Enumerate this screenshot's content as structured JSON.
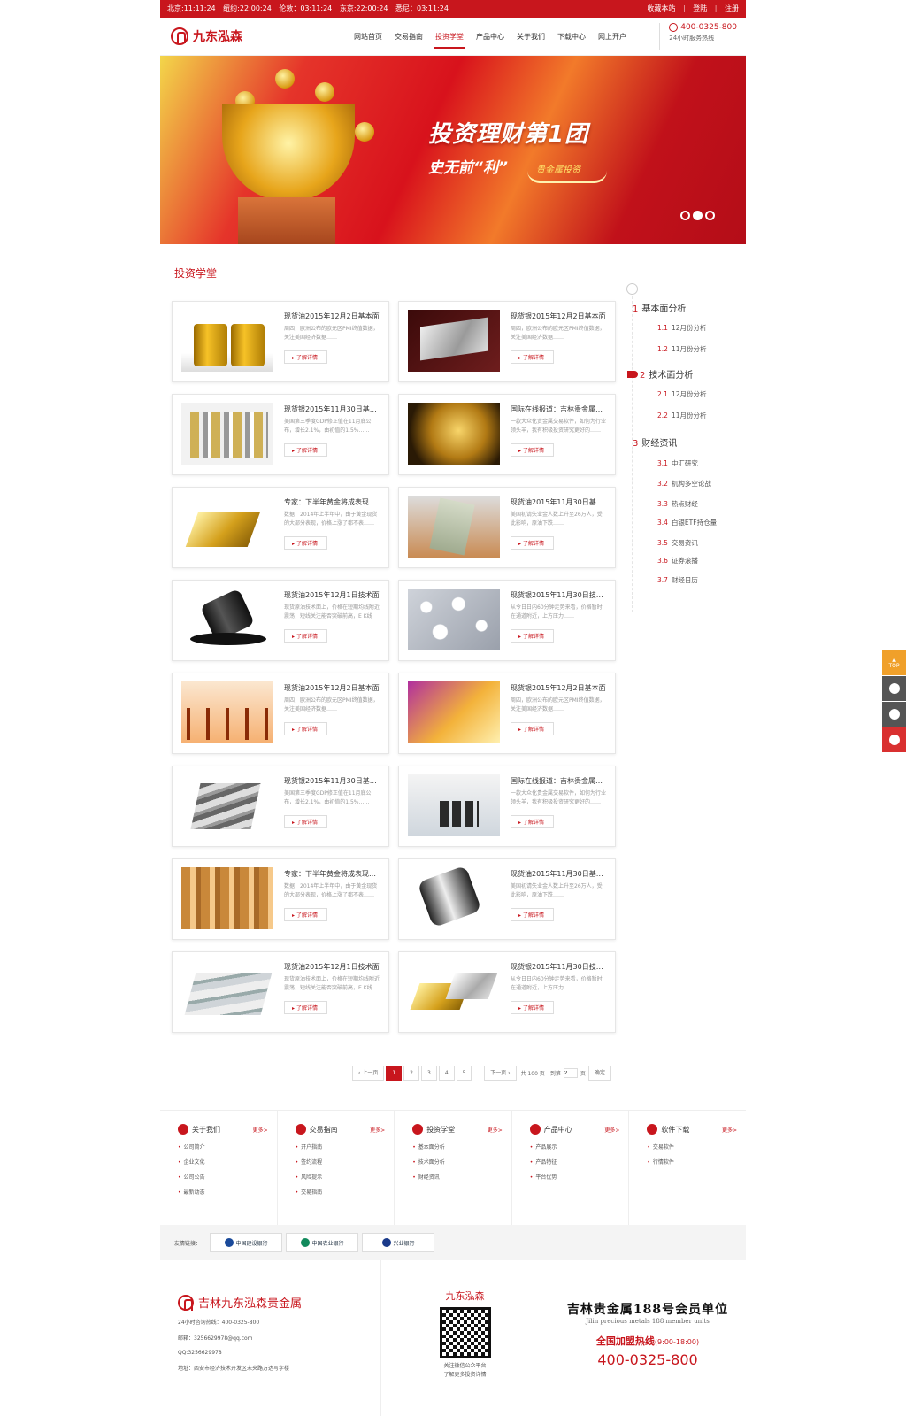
{
  "topbar": {
    "clocks": [
      "北京:11:11:24",
      "纽约:22:00:24",
      "伦敦：03:11:24",
      "东京:22:00:24",
      "悉尼：03:11:24"
    ],
    "links": [
      "收藏本站",
      "登陆",
      "注册"
    ]
  },
  "header": {
    "logo_text": "九东泓森",
    "nav": [
      "网站首页",
      "交易指南",
      "投资学堂",
      "产品中心",
      "关于我们",
      "下载中心",
      "网上开户"
    ],
    "active_nav": "投资学堂",
    "hotline": "400-0325-800",
    "hotline_sub": "24小时服务热线"
  },
  "banner": {
    "title": "投资理财第1团",
    "subtitle": "史无前“利”",
    "tag": "贵金属投资"
  },
  "section_title": "投资学堂",
  "more_label": "了解详情",
  "articles": [
    {
      "title": "现货油2015年12月2日基本面",
      "desc": "周四，欧洲公布的欧元区PMI终值数据，关注美国经济数据……",
      "thumb": "oil-barrels"
    },
    {
      "title": "现货银2015年12月2日基本面",
      "desc": "周四，欧洲公布的欧元区PMI终值数据，关注美国经济数据……",
      "thumb": "silver-bar"
    },
    {
      "title": "现货银2015年11月30日基本面",
      "desc": "美国第三季度GDP修正值在11月底公布，增长2.1%，由初值的1.5%……",
      "thumb": "gold-silver-stacks"
    },
    {
      "title": "国际在线报道：吉林贵金属……",
      "desc": "一款大众化贵金属交易软件，如何为行业领头羊，我有积极投资研究更好的……",
      "thumb": "gold-nugget"
    },
    {
      "title": "专家：下半年黄金将成表现……",
      "desc": "数据：2014年上半年中，由于黄金现货的大部分表现，价格上涨了都不表……",
      "thumb": "gold-bars"
    },
    {
      "title": "现货油2015年11月30日基本面",
      "desc": "美国初请失业金人数上升至26万人，受此影响，原油下跌……",
      "thumb": "dollar-copper"
    },
    {
      "title": "现货油2015年12月1日技术面",
      "desc": "现货原油技术面上，价格在短期均线附近震荡，短线关注能否突破前高，E K线收……",
      "thumb": "oil-spill"
    },
    {
      "title": "现货银2015年11月30日技术面",
      "desc": "从今日日内60分钟走势来看，价格暂时在通道附近，上方压力……",
      "thumb": "mercury-drops"
    },
    {
      "title": "现货油2015年12月2日基本面",
      "desc": "周四，欧洲公布的欧元区PMI终值数据，关注美国经济数据……",
      "thumb": "oil-pumps"
    },
    {
      "title": "现货银2015年12月2日基本面",
      "desc": "周四，欧洲公布的欧元区PMI终值数据，关注美国经济数据……",
      "thumb": "gold-chart"
    },
    {
      "title": "现货银2015年11月30日基本面",
      "desc": "美国第三季度GDP修正值在11月底公布，增长2.1%，由初值的1.5%……",
      "thumb": "silver-stack"
    },
    {
      "title": "国际在线报道：吉林贵金属……",
      "desc": "一款大众化贵金属交易软件，如何为行业领头羊，我有积极投资研究更好的……",
      "thumb": "coins-desk"
    },
    {
      "title": "专家：下半年黄金将成表现……",
      "desc": "数据：2014年上半年中，由于黄金现货的大部分表现，价格上涨了都不表……",
      "thumb": "gold-coins"
    },
    {
      "title": "现货油2015年11月30日基本面",
      "desc": "美国初请失业金人数上升至26万人，受此影响，原油下跌……",
      "thumb": "oil-barrel-tipped"
    },
    {
      "title": "现货油2015年12月1日技术面",
      "desc": "现货原油技术面上，价格在短期均线附近震荡，短线关注能否突破前高，E K线收……",
      "thumb": "silver-bars"
    },
    {
      "title": "现货银2015年11月30日技术面",
      "desc": "从今日日内60分钟走势来看，价格暂时在通道附近，上方压力……",
      "thumb": "gold-silver-bars"
    }
  ],
  "toc": {
    "sections": [
      {
        "num": "1",
        "label": "基本面分析",
        "subs": [
          {
            "num": "1.1",
            "label": "12月份分析"
          },
          {
            "num": "1.2",
            "label": "11月份分析"
          }
        ]
      },
      {
        "num": "2",
        "label": "技术面分析",
        "subs": [
          {
            "num": "2.1",
            "label": "12月份分析"
          },
          {
            "num": "2.2",
            "label": "11月份分析"
          }
        ]
      },
      {
        "num": "3",
        "label": "财经资讯",
        "subs": [
          {
            "num": "3.1",
            "label": "中汇研究"
          },
          {
            "num": "3.2",
            "label": "机构多空论战"
          },
          {
            "num": "3.3",
            "label": "热点财经"
          },
          {
            "num": "3.4",
            "label": "白银ETF持仓量"
          },
          {
            "num": "3.5",
            "label": "交易资讯"
          },
          {
            "num": "3.6",
            "label": "证券滚播"
          },
          {
            "num": "3.7",
            "label": "财经日历"
          }
        ]
      }
    ]
  },
  "pager": {
    "prev": "上一页",
    "pages": [
      "1",
      "2",
      "3",
      "4",
      "5"
    ],
    "current": "1",
    "ellipsis": "...",
    "next": "下一页",
    "total": "共 100 页",
    "goto": "到第",
    "goto_value": "2",
    "page_unit": "页",
    "confirm": "确定"
  },
  "footer_cols": [
    {
      "title": "关于我们",
      "more": "更多>",
      "items": [
        "公司简介",
        "企业文化",
        "公司公告",
        "最新动态"
      ]
    },
    {
      "title": "交易指南",
      "more": "更多>",
      "items": [
        "开户指南",
        "签约流程",
        "风险提示",
        "交易指南"
      ]
    },
    {
      "title": "投资学堂",
      "more": "更多>",
      "items": [
        "基本面分析",
        "技术面分析",
        "财经资讯"
      ]
    },
    {
      "title": "产品中心",
      "more": "更多>",
      "items": [
        "产品展示",
        "产品特征",
        "平台优势"
      ]
    },
    {
      "title": "软件下载",
      "more": "更多>",
      "items": [
        "交易软件",
        "行情软件"
      ]
    }
  ],
  "friends": {
    "label": "友情链接：",
    "links": [
      "中国建设银行",
      "中国农业银行",
      "兴业银行"
    ],
    "colors": [
      "#1a4a9a",
      "#128a5c",
      "#1a3a8a"
    ]
  },
  "bottom": {
    "company": "吉林九东泓森贵金属",
    "info": [
      "24小时咨询热线：400-0325-800",
      "邮箱：3256629978@qq.com",
      "QQ:3256629978",
      "地址：西安市经济技术开发区未央路万达写字楼"
    ],
    "qr_title": "九东泓森",
    "qr_desc": [
      "关注微信公众平台",
      "了解更多投资详情"
    ],
    "member_title": "吉林贵金属188号会员单位",
    "member_en": "Jilin precious metals 188 member units",
    "hotline_label": "全国加盟热线",
    "hotline_hours": "(9:00-18:00)",
    "hotline_number": "400-0325-800"
  },
  "float_bar": {
    "top_label": "TOP"
  }
}
